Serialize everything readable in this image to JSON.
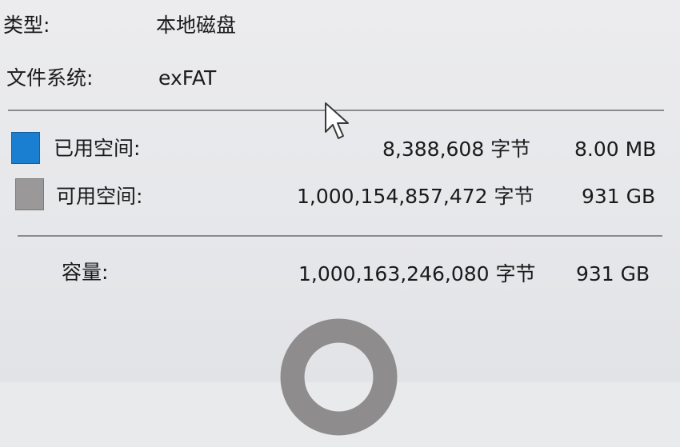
{
  "properties": {
    "type_label": "类型:",
    "type_value": "本地磁盘",
    "filesystem_label": "文件系统:",
    "filesystem_value": "exFAT"
  },
  "space": {
    "used": {
      "label": "已用空间:",
      "bytes": "8,388,608 字节",
      "size": "8.00 MB",
      "color": "#1a7fd0"
    },
    "free": {
      "label": "可用空间:",
      "bytes": "1,000,154,857,472 字节",
      "size": "931 GB",
      "color": "#9a9898"
    },
    "capacity": {
      "label": "容量:",
      "bytes": "1,000,163,246,080 字节",
      "size": "931 GB"
    }
  },
  "donut": {
    "used_fraction": 8.4e-06,
    "used_color": "#1a7fd0",
    "free_color": "#8e8c8c"
  },
  "icons": {
    "cursor": "mouse-pointer-icon"
  }
}
